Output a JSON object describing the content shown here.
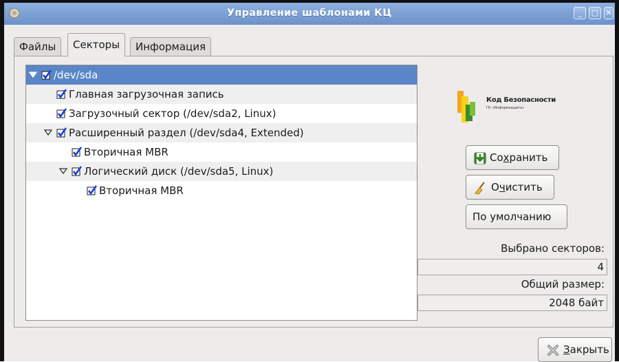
{
  "window": {
    "title": "Управление шаблонами КЦ",
    "buttons": {
      "minimize": "_",
      "maximize": "□",
      "close": "✕"
    }
  },
  "tabs": [
    {
      "label": "Файлы",
      "active": false
    },
    {
      "label": "Секторы",
      "active": true
    },
    {
      "label": "Информация",
      "active": false
    }
  ],
  "tree": {
    "rows": [
      {
        "label": "/dev/sda",
        "level": 0,
        "expander": "expanded",
        "checked": true,
        "selected": true
      },
      {
        "label": "Главная загрузочная запись",
        "level": 1,
        "expander": "none",
        "checked": true,
        "selected": false
      },
      {
        "label": "Загрузочный сектор (/dev/sda2, Linux)",
        "level": 1,
        "expander": "none",
        "checked": true,
        "selected": false
      },
      {
        "label": "Расширенный раздел (/dev/sda4, Extended)",
        "level": 1,
        "expander": "expanded",
        "checked": true,
        "selected": false
      },
      {
        "label": "Вторичная MBR",
        "level": 2,
        "expander": "none",
        "checked": true,
        "selected": false
      },
      {
        "label": "Логический диск (/dev/sda5, Linux)",
        "level": 2,
        "expander": "expanded",
        "checked": true,
        "selected": false
      },
      {
        "label": "Вторичная MBR",
        "level": 3,
        "expander": "none",
        "checked": true,
        "selected": false
      }
    ]
  },
  "logo": {
    "title": "Код Безопасности",
    "subtitle": "ГК «Информзащита»"
  },
  "buttons": {
    "save": {
      "pre": "Со",
      "mnemonic": "х",
      "post": "ранить",
      "icon": "save-icon"
    },
    "clear": {
      "pre": "О",
      "mnemonic": "ч",
      "post": "истить",
      "icon": "broom-icon"
    },
    "default": {
      "label": "По умолчанию"
    },
    "close": {
      "pre": "",
      "mnemonic": "З",
      "post": "акрыть",
      "icon": "close-icon"
    }
  },
  "stats": {
    "selected_label": "Выбрано секторов:",
    "selected_value": "4",
    "size_label": "Общий размер:",
    "size_value": "2048 байт"
  },
  "colors": {
    "titlebar": "#7aa0d4",
    "selection": "#5a86c7",
    "checkmark": "#1a3fd6"
  }
}
